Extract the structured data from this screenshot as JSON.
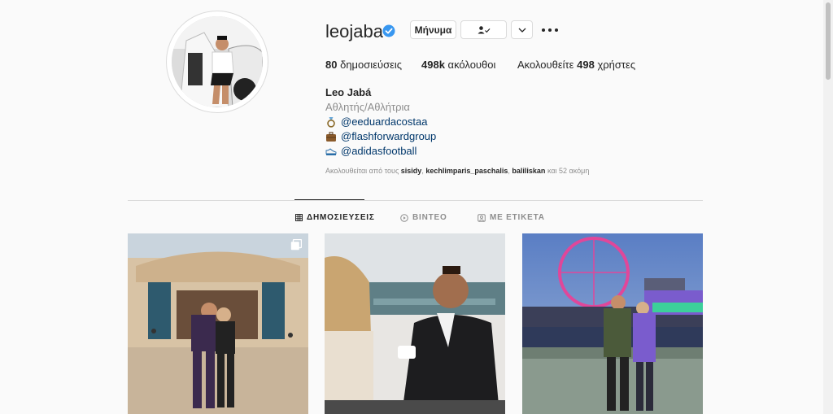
{
  "profile": {
    "username": "leojaba",
    "message_label": "Μήνυμα",
    "posts_count": "80",
    "posts_label": "δημοσιεύσεις",
    "followers_count": "498k",
    "followers_label": "ακόλουθοι",
    "following_prefix": "Ακολουθείτε",
    "following_count": "498",
    "following_suffix": "χρήστες"
  },
  "bio": {
    "name": "Leo Jabá",
    "category": "Αθλητής/Αθλήτρια",
    "links": [
      "@eeduardacostaa",
      "@flashforwardgroup",
      "@adidasfootball"
    ],
    "followed_by_prefix": "Ακολουθείται από τους",
    "followed_by_users": [
      "sisidy",
      "kechlimparis_paschalis",
      "baliliskan"
    ],
    "followed_by_suffix": "και 52 ακόμη"
  },
  "tabs": [
    {
      "label": "ΔΗΜΟΣΙΕΥΣΕΙΣ",
      "icon": "grid-icon",
      "active": true
    },
    {
      "label": "ΒΙΝΤΕΟ",
      "icon": "video-icon",
      "active": false
    },
    {
      "label": "ΜΕ ΕΤΙΚΕΤΑ",
      "icon": "tag-icon",
      "active": false
    }
  ],
  "colors": {
    "background": "#fafafa",
    "verified_blue": "#3897f0",
    "link_blue": "#00376b",
    "muted_gray": "#8e8e8e",
    "border": "#dbdbdb"
  }
}
